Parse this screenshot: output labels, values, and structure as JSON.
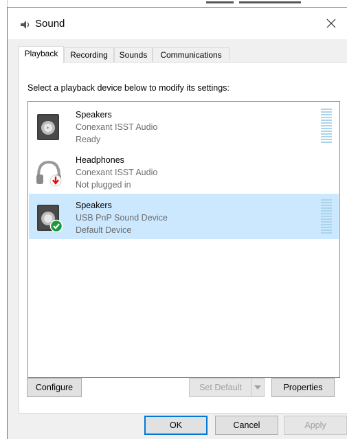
{
  "window": {
    "title": "Sound",
    "icon": "speaker-icon",
    "close_icon": "close-icon"
  },
  "tabs": [
    {
      "label": "Playback",
      "active": true
    },
    {
      "label": "Recording",
      "active": false
    },
    {
      "label": "Sounds",
      "active": false
    },
    {
      "label": "Communications",
      "active": false
    }
  ],
  "playback": {
    "instruction": "Select a playback device below to modify its settings:",
    "devices": [
      {
        "name": "Speakers",
        "driver": "Conexant ISST Audio",
        "status": "Ready",
        "icon": "speaker-icon",
        "selected": false
      },
      {
        "name": "Headphones",
        "driver": "Conexant ISST Audio",
        "status": "Not plugged in",
        "icon": "headphones-icon",
        "selected": false
      },
      {
        "name": "Speakers",
        "driver": "USB PnP Sound Device",
        "status": "Default Device",
        "icon": "speaker-default-icon",
        "selected": true
      }
    ]
  },
  "buttons": {
    "configure": "Configure",
    "set_default": "Set Default",
    "properties": "Properties",
    "ok": "OK",
    "cancel": "Cancel",
    "apply": "Apply"
  },
  "colors": {
    "selection": "#cce8ff",
    "accent": "#0078d7",
    "meter": "#a9d4eb"
  }
}
